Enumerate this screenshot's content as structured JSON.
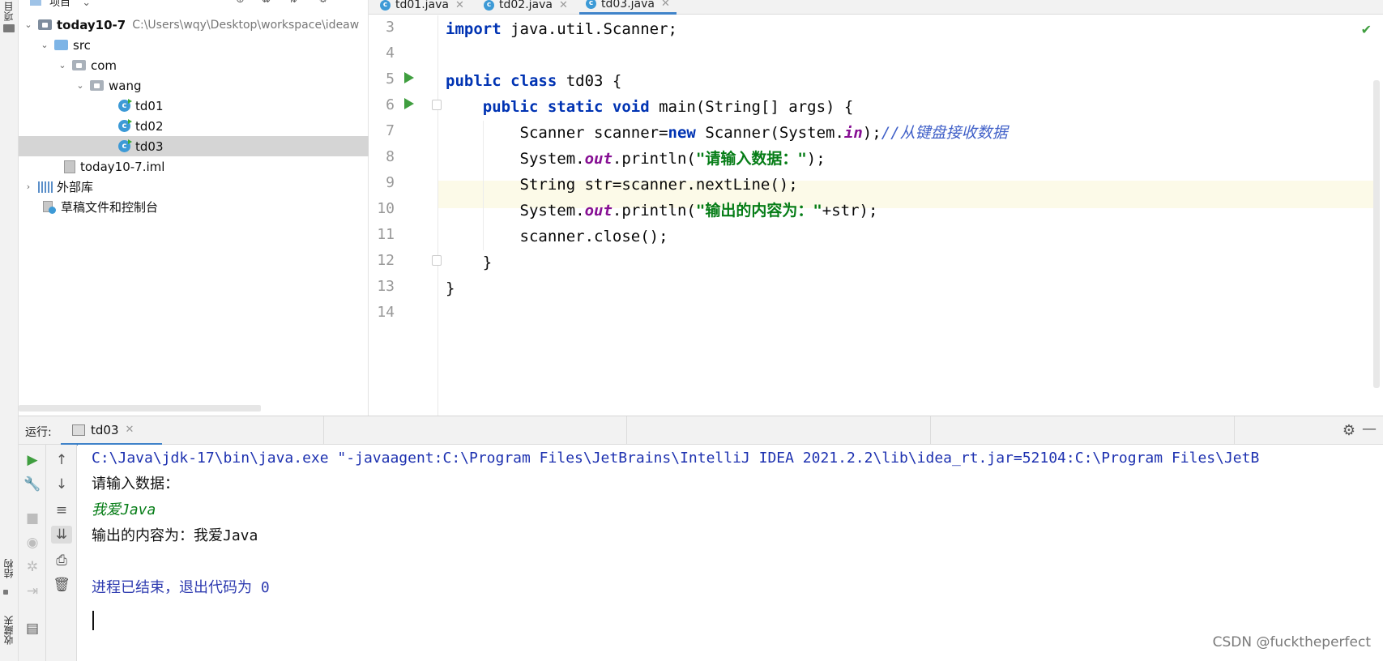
{
  "side_stripe": {
    "top_label": "项目",
    "bottom_label_1": "结构",
    "bottom_label_2": "收藏夹"
  },
  "project": {
    "header_label": "项目",
    "tree": [
      {
        "label": "today10-7",
        "path": "C:\\Users\\wqy\\Desktop\\workspace\\ideaw"
      },
      {
        "label": "src"
      },
      {
        "label": "com"
      },
      {
        "label": "wang"
      },
      {
        "label": "td01"
      },
      {
        "label": "td02"
      },
      {
        "label": "td03"
      },
      {
        "label": "today10-7.iml"
      },
      {
        "label": "外部库"
      },
      {
        "label": "草稿文件和控制台"
      }
    ]
  },
  "tabs": [
    {
      "label": "td01.java"
    },
    {
      "label": "td02.java"
    },
    {
      "label": "td03.java",
      "active": true
    }
  ],
  "editor": {
    "line_numbers": [
      "3",
      "4",
      "5",
      "6",
      "7",
      "8",
      "9",
      "10",
      "11",
      "12",
      "13",
      "14"
    ],
    "current_line": "9"
  },
  "run": {
    "label": "运行:",
    "tab_label": "td03"
  },
  "console": {
    "cmd": "C:\\Java\\jdk-17\\bin\\java.exe \"-javaagent:C:\\Program Files\\JetBrains\\IntelliJ IDEA 2021.2.2\\lib\\idea_rt.jar=52104:C:\\Program Files\\JetB",
    "prompt": "请输入数据：",
    "input": "我爱Java",
    "output": "输出的内容为：我爱Java",
    "exit": "进程已结束，退出代码为 0"
  },
  "watermark": "CSDN @fucktheperfect",
  "colors": {
    "keyword": "#0033b3",
    "string": "#067d17",
    "static_field": "#871094",
    "comment": "#4060c8",
    "accent_tab": "#4083c9",
    "run_green": "#3f9e3f"
  }
}
